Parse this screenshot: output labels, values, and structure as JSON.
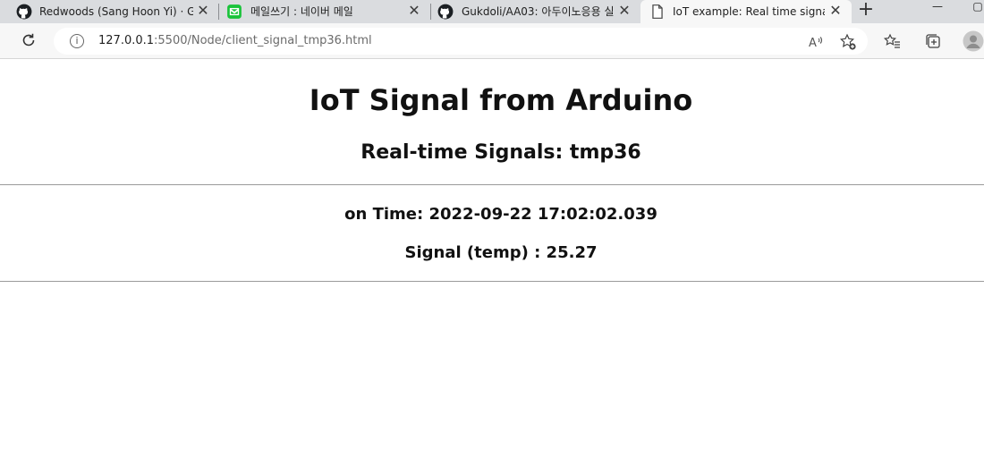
{
  "tabs": [
    {
      "title": "Redwoods (Sang Hoon Yi) · GitH",
      "icon": "github-icon"
    },
    {
      "title": "메일쓰기 : 네이버 메일",
      "icon": "naver-mail-icon"
    },
    {
      "title": "Gukdoli/AA03: 아두이노응용 실",
      "icon": "github-icon"
    },
    {
      "title": "IoT example: Real time signal fro",
      "icon": "document-icon"
    }
  ],
  "close_glyph": "✕",
  "new_tab_glyph": "+",
  "window_controls": {
    "minimize": "—",
    "restore": "▢"
  },
  "address": {
    "host": "127.0.0.1",
    "path": ":5500/Node/client_signal_tmp36.html"
  },
  "page": {
    "title": "IoT Signal from Arduino",
    "subtitle": "Real-time Signals: tmp36",
    "time_line": "on Time: 2022-09-22 17:02:02.039",
    "signal_line": "Signal (temp) : 25.27"
  }
}
